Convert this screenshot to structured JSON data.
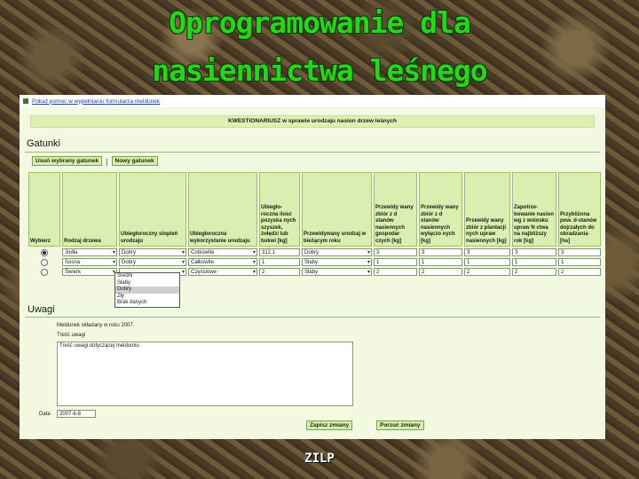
{
  "slide": {
    "title_line1": "Oprogramowanie dla",
    "title_line2": "nasiennictwa leśnego",
    "footer": "ZILP"
  },
  "app": {
    "help_link": "Pokaż pomoc w wypełnianiu formularza meldunek",
    "form_title": "KWESTIONARIUSZ w sprawie urodzaju nasion drzew leśnych",
    "species_section": "Gatunki",
    "remove_button": "Usuń wybrany gatunek",
    "new_button": "Nowy gatunek",
    "separator": "|",
    "columns": [
      "Wybierz",
      "Rodzaj drzewa",
      "Ubiegłoroczny stopień urodzaju",
      "Ubiegłoroczna wykorzystanie urodzaju",
      "Ubiegło-roczna ilość pozyska nych szyszek, żołędzi lub bukwi [kg]",
      "Przewidywany urodzaj w bieżącym roku",
      "Przewidy wany zbiór z d stanów nasiennych gospodar czych [kg]",
      "Przewidy wany zbiór z d stanów nasiennych wyłączo nych [kg]",
      "Przewidy wany zbiór z plantacji nych upraw nasiennych [kg]",
      "Zapotrze-bowanie nasion wg z wniosku upraw N ctwa na najbliższy rok [kg]",
      "Przybliżona pow. d-stanów dojrzałych do obradzania [ha]"
    ],
    "rows": [
      {
        "selected": true,
        "species": "Jodła",
        "prev_yield": "Dobry",
        "usage": "Cotkowite",
        "qty": "312,1",
        "forecast": "Dobry",
        "c1": "3",
        "c2": "3",
        "c3": "3",
        "c4": "3",
        "c5": "3"
      },
      {
        "selected": false,
        "species": "Sosna",
        "prev_yield": "Dobry",
        "usage": "Całkowite",
        "qty": "1",
        "forecast": "Słaby",
        "c1": "1",
        "c2": "1",
        "c3": "1",
        "c4": "1",
        "c5": "1"
      },
      {
        "selected": false,
        "species": "Świerk",
        "prev_yield": "",
        "usage": "Częściowe",
        "qty": "2",
        "forecast": "Słaby",
        "c1": "2",
        "c2": "2",
        "c3": "2",
        "c4": "2",
        "c5": "2"
      }
    ],
    "dropdown_options": [
      "Średni",
      "Słaby",
      "Dobry",
      "Zły",
      "Brak danych"
    ],
    "dropdown_highlighted": "Dobry",
    "remarks_section": "Uwagi",
    "remarks_note": "Meldunek składany w roku 2007.",
    "remarks_label": "Treść uwagi",
    "remarks_text": "Treść uwagi dotyczącej meldunku",
    "date_label": "Data",
    "date_value": "2007-6-8",
    "save_button": "Zapisz zmiany",
    "discard_button": "Porzuć zmiany"
  },
  "colors": {
    "title_green": "#2bd41c",
    "panel_bg": "#f3f9e0",
    "header_bg": "#d9eeb0",
    "button_bg": "#d7edb0"
  }
}
